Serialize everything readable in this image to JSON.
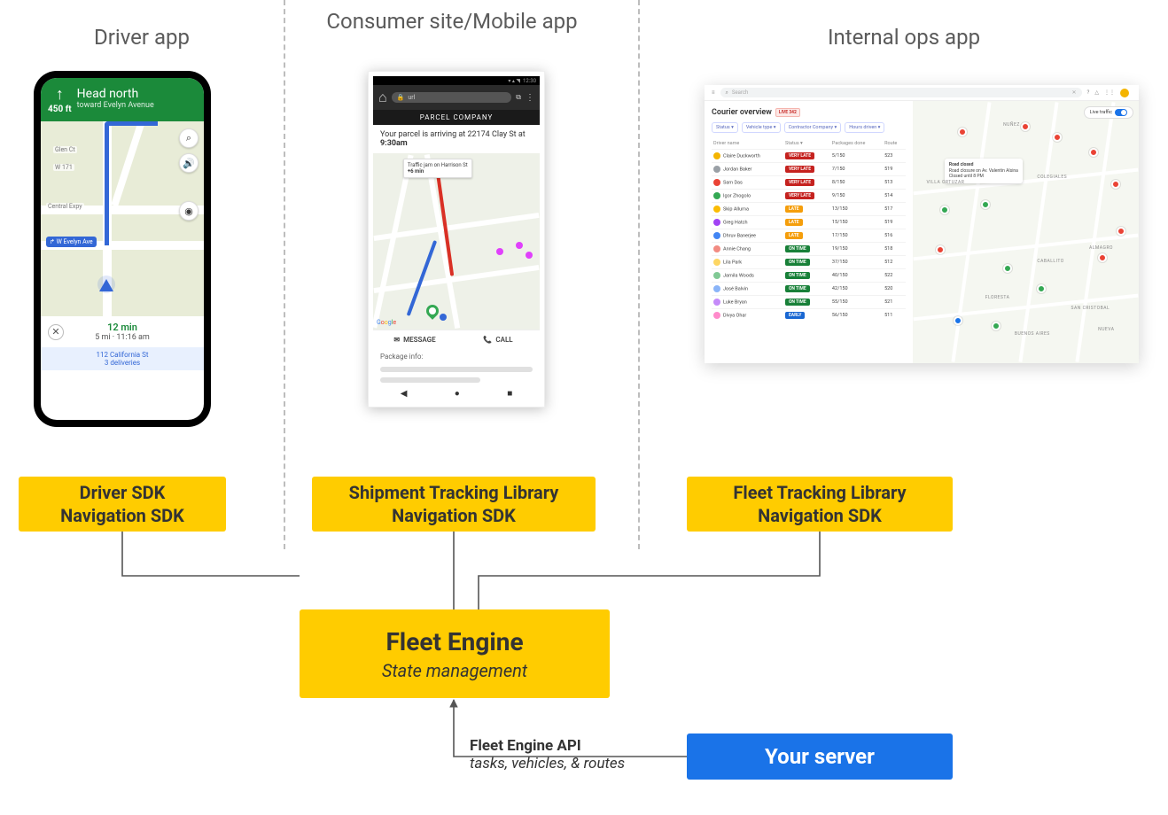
{
  "columns": {
    "driver": "Driver app",
    "consumer": "Consumer site/Mobile app",
    "ops": "Internal ops app"
  },
  "sdk_boxes": {
    "driver": {
      "line1": "Driver SDK",
      "line2": "Navigation SDK"
    },
    "consumer": {
      "line1": "Shipment Tracking Library",
      "line2": "Navigation SDK"
    },
    "ops": {
      "line1": "Fleet Tracking Library",
      "line2": "Navigation SDK"
    }
  },
  "engine": {
    "title": "Fleet Engine",
    "subtitle": "State management"
  },
  "server": {
    "label": "Your server"
  },
  "api_label": {
    "bold": "Fleet Engine API",
    "italic": "tasks, vehicles, & routes"
  },
  "driver_phone": {
    "direction_main": "Head north",
    "direction_sub": "toward Evelyn Avenue",
    "distance": "450 ft",
    "streets": {
      "central": "Central Expy",
      "evelyn": "↱ W Evelyn Ave",
      "glen": "Glen Ct",
      "w171": "W 171"
    },
    "eta": {
      "time": "12 min",
      "detail": "5 mi · 11:16 am"
    },
    "next_stop": {
      "name": "112 California St",
      "sub": "3 deliveries"
    },
    "icons": {
      "search": "⌕",
      "sound": "🔊",
      "compass": "◉",
      "close": "✕",
      "arrow_up": "↑"
    }
  },
  "consumer_browser": {
    "status_time": "12:30",
    "url_placeholder": "url",
    "header": "PARCEL COMPANY",
    "eta_line": "Your parcel is arriving at 22174 Clay St at",
    "eta_bold": "9:30am",
    "traffic_chip": {
      "line1": "Traffic jam on Harrison St",
      "line2": "+6 min"
    },
    "buttons": {
      "message": "MESSAGE",
      "call": "CALL"
    },
    "pkg_header": "Package info:",
    "google_logo": "Google",
    "icons": {
      "lock": "🔒",
      "tab": "⧉",
      "menu": "⋮",
      "msg": "✉",
      "phone": "📞",
      "back": "◀",
      "home": "●",
      "recent": "■"
    }
  },
  "ops_dash": {
    "search_placeholder": "Search",
    "title": "Courier overview",
    "live_badge": "LIVE 342",
    "filters": [
      "Status ▾",
      "Vehicle type ▾",
      "Contractor Company ▾",
      "Hours driven ▾"
    ],
    "columns": [
      "Driver name",
      "Status ▾",
      "Packages done",
      "Route"
    ],
    "rows": [
      {
        "name": "Claire Duckworth",
        "status": "VERY LATE",
        "status_cls": "vl",
        "pk": "5/150",
        "rt": "523",
        "av": "#f4b400"
      },
      {
        "name": "Jordan Baker",
        "status": "VERY LATE",
        "status_cls": "vl",
        "pk": "7/150",
        "rt": "519",
        "av": "#9aa0a6"
      },
      {
        "name": "Sam Das",
        "status": "VERY LATE",
        "status_cls": "vl",
        "pk": "8/150",
        "rt": "513",
        "av": "#ea4335"
      },
      {
        "name": "Igor Zhogolo",
        "status": "VERY LATE",
        "status_cls": "vl",
        "pk": "9/150",
        "rt": "514",
        "av": "#34a853"
      },
      {
        "name": "Skip Alluma",
        "status": "LATE",
        "status_cls": "lt",
        "pk": "13/150",
        "rt": "517",
        "av": "#fbbc04"
      },
      {
        "name": "Greg Hatch",
        "status": "LATE",
        "status_cls": "lt",
        "pk": "15/150",
        "rt": "519",
        "av": "#a142f4"
      },
      {
        "name": "Dhruv Banerjee",
        "status": "LATE",
        "status_cls": "lt",
        "pk": "17/150",
        "rt": "516",
        "av": "#4285f4"
      },
      {
        "name": "Annie Chang",
        "status": "ON TIME",
        "status_cls": "ot",
        "pk": "19/150",
        "rt": "518",
        "av": "#f28b82"
      },
      {
        "name": "Lila Park",
        "status": "ON TIME",
        "status_cls": "ot",
        "pk": "37/150",
        "rt": "512",
        "av": "#fdd663"
      },
      {
        "name": "Jamila Woods",
        "status": "ON TIME",
        "status_cls": "ot",
        "pk": "40/150",
        "rt": "522",
        "av": "#81c995"
      },
      {
        "name": "José Balvin",
        "status": "ON TIME",
        "status_cls": "ot",
        "pk": "42/150",
        "rt": "520",
        "av": "#8ab4f8"
      },
      {
        "name": "Luke Bryan",
        "status": "ON TIME",
        "status_cls": "ot",
        "pk": "55/150",
        "rt": "521",
        "av": "#c58af9"
      },
      {
        "name": "Divya Ohar",
        "status": "EARLY",
        "status_cls": "er",
        "pk": "56/150",
        "rt": "511",
        "av": "#ff8bcb"
      }
    ],
    "popup": {
      "title": "Road closed",
      "line2": "Road closure on Av. Valentín Alsina",
      "line3": "Closed until 8 PM"
    },
    "live_traffic": "Live traffic",
    "areas": [
      "NUÑEZ",
      "COLEGIALES",
      "VILLA ORTUZAR",
      "ALMAGRO",
      "CABALLITO",
      "FLORESTA",
      "NUEVA",
      "BUENOS AIRES",
      "SAN CRISTOBAL"
    ],
    "close_icon": "✕",
    "icons": {
      "menu": "≡",
      "search": "⌕",
      "help": "?",
      "bell": "🔔",
      "apps": "⋮⋮⋮"
    }
  }
}
